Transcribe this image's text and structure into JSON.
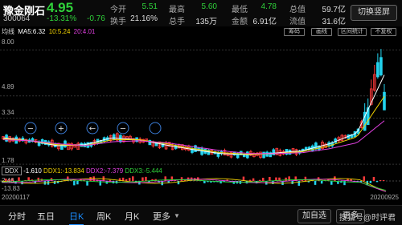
{
  "quote": {
    "name": "豫金刚石",
    "price": "4.95",
    "code": "300064",
    "pct": "-13.31%",
    "chg": "-0.76",
    "rows": [
      {
        "l1": "今开",
        "v1": "5.51",
        "c1": "#2fd13a",
        "l2": "最高",
        "v2": "5.60",
        "c2": "#2fd13a",
        "l3": "最低",
        "v3": "4.78",
        "c3": "#2fd13a",
        "l4": "总值",
        "v4": "59.7亿",
        "c4": "#ddd"
      },
      {
        "l1": "换手",
        "v1": "21.16%",
        "c1": "#ddd",
        "l2": "总手",
        "v2": "135万",
        "c2": "#ddd",
        "l3": "金额",
        "v3": "6.91亿",
        "c3": "#ddd",
        "l4": "流值",
        "v4": "31.6亿",
        "c4": "#ddd"
      }
    ],
    "switch_label": "切换竖屏"
  },
  "ma": {
    "title": "均线",
    "ma5": "MA5:6.32",
    "ma10": "10:5.24",
    "ma20": "20:4.01",
    "colors": {
      "ma5": "#ffffff",
      "ma10": "#f0d000",
      "ma20": "#e040e0"
    }
  },
  "tools": [
    "筹码",
    "画线",
    "区间统计",
    "不复权"
  ],
  "axis": {
    "top": "8.00",
    "mid": "4.89",
    "low": "3.34",
    "bottom": "1.78"
  },
  "ddx": {
    "title": "DDX",
    "v0": "-1.610",
    "v1": "DDX1:-13.834",
    "v2": "DDX2:-7.379",
    "v3": "DDX3:-5.444",
    "axis_top": "2.46",
    "axis_bottom": "-13.83",
    "date_start": "20200117",
    "date_end": "20200925"
  },
  "tabs": [
    {
      "label": "分时"
    },
    {
      "label": "五日"
    },
    {
      "label": "日K"
    },
    {
      "label": "周K"
    },
    {
      "label": "月K"
    },
    {
      "label": "更多"
    }
  ],
  "actions": {
    "add": "加自选",
    "more": "更多"
  },
  "watermark": "搜狐号@时评君",
  "colors": {
    "up": "#ff3b3b",
    "down": "#22d3ee",
    "accent": "#1a8cff",
    "green": "#2fd13a"
  },
  "chart_data": {
    "type": "line",
    "title": "",
    "xlabel": "",
    "ylabel": "",
    "x": [
      "20200117",
      "20200925"
    ],
    "ylim": [
      1.78,
      8.0
    ],
    "series": [
      {
        "name": "MA5",
        "values": [
          3.15,
          3.0,
          2.75,
          2.8,
          3.15,
          3.05,
          2.78,
          2.55,
          2.35,
          2.3,
          2.38,
          2.5,
          2.85,
          3.4,
          6.32
        ]
      },
      {
        "name": "MA10",
        "values": [
          3.1,
          3.0,
          2.8,
          2.75,
          3.05,
          3.05,
          2.85,
          2.6,
          2.4,
          2.32,
          2.35,
          2.45,
          2.75,
          3.2,
          5.24
        ]
      },
      {
        "name": "MA20",
        "values": [
          3.05,
          3.0,
          2.85,
          2.75,
          2.95,
          3.0,
          2.9,
          2.7,
          2.5,
          2.36,
          2.35,
          2.4,
          2.6,
          2.9,
          4.01
        ]
      }
    ]
  }
}
